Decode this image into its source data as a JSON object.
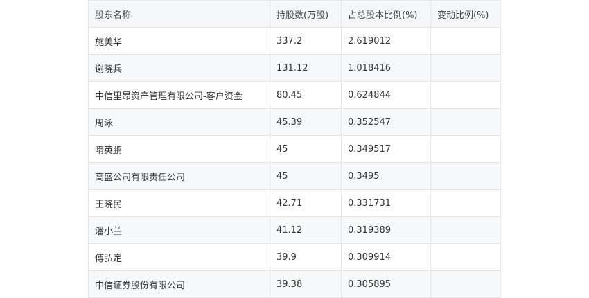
{
  "table": {
    "headers": [
      "股东名称",
      "持股数(万股)",
      "占总股本比例(%)",
      "变动比例(%)"
    ],
    "rows": [
      [
        "施美华",
        "337.2",
        "2.619012",
        ""
      ],
      [
        "谢晓兵",
        "131.12",
        "1.018416",
        ""
      ],
      [
        "中信里昂资产管理有限公司-客户资金",
        "80.45",
        "0.624844",
        ""
      ],
      [
        "周泳",
        "45.39",
        "0.352547",
        ""
      ],
      [
        "隋英鹏",
        "45",
        "0.349517",
        ""
      ],
      [
        "高盛公司有限责任公司",
        "45",
        "0.3495",
        ""
      ],
      [
        "王晓民",
        "42.71",
        "0.331731",
        ""
      ],
      [
        "潘小兰",
        "41.12",
        "0.319389",
        ""
      ],
      [
        "傅弘定",
        "39.9",
        "0.309914",
        ""
      ],
      [
        "中信证券股份有限公司",
        "39.38",
        "0.305895",
        ""
      ]
    ]
  }
}
